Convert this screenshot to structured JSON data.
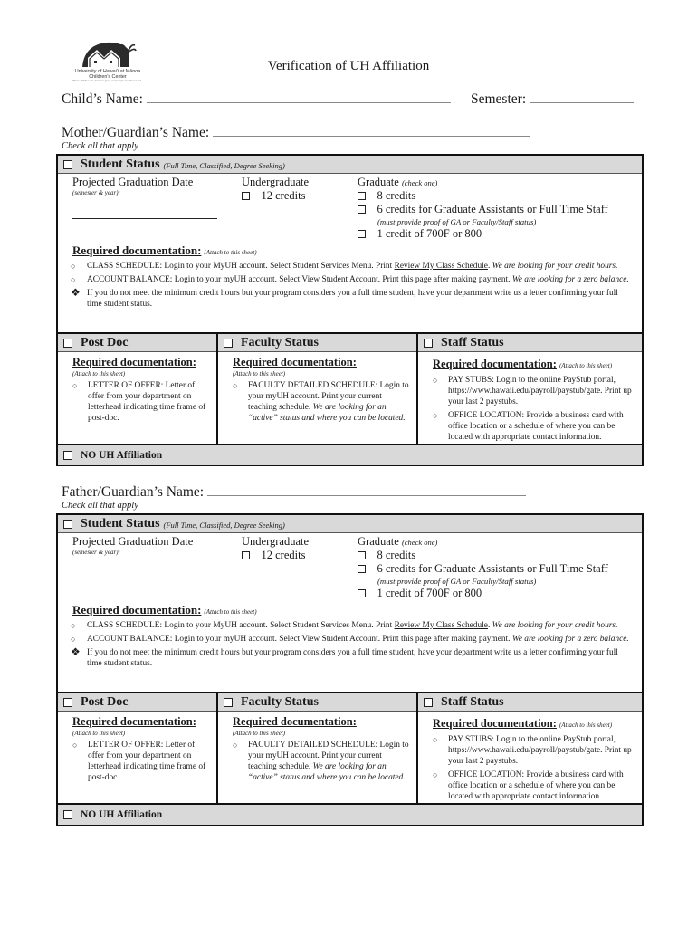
{
  "logo": {
    "line1": "University of Hawaiʻi at Mānoa",
    "line2": "Children's Center",
    "tagline": "Where children can, families grow, and people are discovered..."
  },
  "title": "Verification of UH Affiliation",
  "fields": {
    "child_name_label": "Child’s Name:",
    "child_name_value": "",
    "semester_label": "Semester:",
    "semester_value": "",
    "mother_label": "Mother/Guardian’s Name:",
    "mother_value": "",
    "father_label": "Father/Guardian’s Name:",
    "father_value": ""
  },
  "check_all": "Check all that apply",
  "student_status": {
    "title": "Student Status",
    "subtitle": "(Full Time, Classified, Degree Seeking)",
    "proj_grad_label": "Projected Graduation Date",
    "proj_grad_hint": "(semester & year):",
    "proj_grad_value": "",
    "undergrad_label": "Undergraduate",
    "undergrad_option": "12 credits",
    "grad_label": "Graduate",
    "grad_hint": "(check one)",
    "grad_options": [
      "8 credits",
      "6 credits for Graduate Assistants or Full Time Staff",
      "1 credit of 700F or 800"
    ],
    "grad_note": "(must provide proof of GA or Faculty/Staff status)",
    "req_title": "Required documentation:",
    "req_note": "(Attach to this sheet)",
    "bullets": [
      {
        "lead": "CLASS SCHEDULE:  Login to your MyUH account. Select Student Services Menu. Print ",
        "link": "Review My Class Schedule",
        "tail": ".  ",
        "italic": "We are looking for your credit hours."
      },
      {
        "lead": "ACCOUNT BALANCE: Login to your myUH account. Select View Student Account. Print this page after making payment.  ",
        "italic": "We are looking for a zero balance."
      }
    ],
    "note": "If you do not meet the minimum credit hours but your program considers you a full time student, have your department write us a letter confirming your full time student status."
  },
  "post_doc": {
    "title": "Post Doc",
    "req_title": "Required documentation:",
    "req_note": "(Attach to this sheet)",
    "bullet": "LETTER OF OFFER: Letter of offer from your department on letterhead indicating time frame of post-doc."
  },
  "faculty": {
    "title": "Faculty Status",
    "req_title": "Required documentation:",
    "req_note": "(Attach to this sheet)",
    "bullet_lead": "FACULTY DETAILED SCHEDULE: Login to your myUH account. Print your current teaching schedule. ",
    "bullet_italic": "We are looking for an “active” status and where you can be located."
  },
  "staff": {
    "title": "Staff Status",
    "req_title": "Required documentation:",
    "req_note": "(Attach to this sheet)",
    "bullets": [
      "PAY STUBS: Login to the online PayStub portal, https://www.hawaii.edu/payroll/paystub/gate. Print up your last 2 paystubs.",
      "OFFICE LOCATION: Provide a business card with office location or a schedule of where you can be located with appropriate contact information."
    ]
  },
  "no_affiliation": "NO UH Affiliation"
}
